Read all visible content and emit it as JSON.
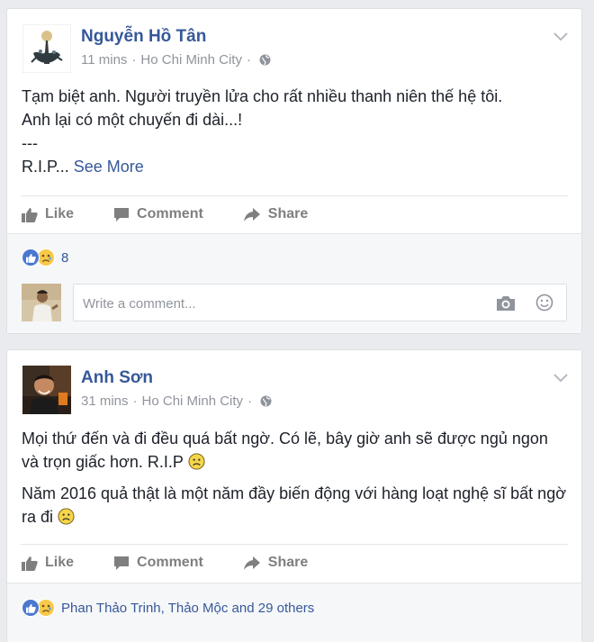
{
  "posts": [
    {
      "author": "Nguyễn Hồ Tân",
      "time": "11 mins",
      "location": "Ho Chi Minh City",
      "paragraphs": [
        "Tạm biệt anh. Người truyền lửa cho rất nhiều thanh niên thế hệ tôi.",
        "Anh lại có một chuyến đi dài...!",
        "---"
      ],
      "last_line": "R.I.P...",
      "see_more": "See More",
      "actions": {
        "like": "Like",
        "comment": "Comment",
        "share": "Share"
      },
      "reaction_summary": "8",
      "comment_placeholder": "Write a comment..."
    },
    {
      "author": "Anh Sơn",
      "time": "31 mins",
      "location": "Ho Chi Minh City",
      "paragraphs": [
        "Mọi thứ đến và đi đều quá bất ngờ. Có lẽ, bây giờ anh sẽ được ngủ ngon và trọn giấc hơn. R.I.P",
        "Năm 2016 quả thật là một năm đầy biến động với hàng loạt nghệ sĩ bất ngờ ra đi"
      ],
      "actions": {
        "like": "Like",
        "comment": "Comment",
        "share": "Share"
      },
      "reaction_summary": "Phan Thảo Trinh, Thảo Mộc and 29 others"
    }
  ],
  "meta_separator": "·",
  "icons": {
    "globe": "globe-icon",
    "chevron": "chevron-down-icon",
    "like": "thumbs-up-icon",
    "comment": "comment-icon",
    "share": "share-arrow-icon",
    "camera": "camera-icon",
    "emoji": "smiley-icon",
    "sad": "sad-face-icon"
  },
  "colors": {
    "link": "#365899",
    "muted": "#90949c",
    "action": "#7f7f7f",
    "like_reaction": "#4a78d0",
    "sad_reaction": "#f7c948"
  }
}
